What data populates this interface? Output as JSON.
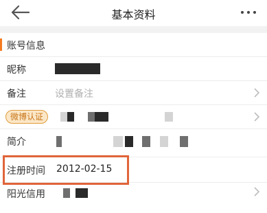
{
  "header": {
    "back_icon": "back-arrow-icon",
    "title": "基本资料",
    "more_icon": "more-dots-icon"
  },
  "section": {
    "label": "账号信息",
    "accent_color": "#f57c22"
  },
  "rows": {
    "nickname": {
      "label": "昵称"
    },
    "note": {
      "label": "备注",
      "placeholder": "设置备注"
    },
    "weibo": {
      "badge": "微博认证"
    },
    "intro": {
      "label": "简介"
    },
    "register": {
      "label": "注册时间",
      "value": "2012-02-15"
    },
    "credit": {
      "label": "阳光信用"
    }
  },
  "highlight_color": "#e0643a"
}
